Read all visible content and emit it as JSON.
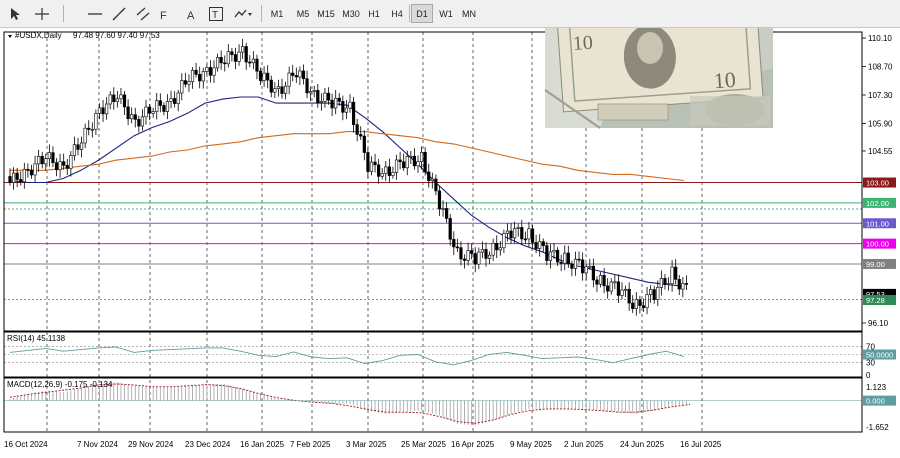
{
  "toolbar": {
    "timeframes": [
      "M1",
      "M5",
      "M15",
      "M30",
      "H1",
      "H4",
      "D1",
      "W1",
      "MN"
    ],
    "active_timeframe": "D1"
  },
  "chart_header": {
    "symbol_label": "#USDX,Daily",
    "ohlc": "97.48 97.60 97.40 97.53"
  },
  "price_axis": {
    "labels": [
      "110.10",
      "108.70",
      "107.30",
      "105.90",
      "104.55",
      "103.00",
      "102.00",
      "101.00",
      "100.00",
      "99.00",
      "97.53",
      "97.28",
      "96.10"
    ]
  },
  "levels": [
    {
      "price": 103.0,
      "label": "103.00",
      "color": "#8b1a1a",
      "style": "solid"
    },
    {
      "price": 102.0,
      "label": "102.00",
      "color": "#3cb371",
      "style": "solid"
    },
    {
      "price": 101.0,
      "label": "101.00",
      "color": "#6a5acd",
      "style": "solid"
    },
    {
      "price": 100.0,
      "label": "100.00",
      "color": "#ee00ee",
      "style": "solid"
    },
    {
      "price": 99.0,
      "label": "99.00",
      "color": "#808080",
      "style": "solid"
    }
  ],
  "current_price": {
    "bid": "97.53",
    "mark": "97.28"
  },
  "date_axis": {
    "labels": [
      "16 Oct 2024",
      "7 Nov 2024",
      "29 Nov 2024",
      "23 Dec 2024",
      "16 Jan 2025",
      "7 Feb 2025",
      "3 Mar 2025",
      "25 Mar 2025",
      "16 Apr 2025",
      "9 May 2025",
      "2 Jun 2025",
      "24 Jun 2025",
      "16 Jul 2025"
    ]
  },
  "rsi": {
    "label": "RSI(14) 45.1138",
    "levels": [
      "70",
      "50.0000",
      "30",
      "0"
    ],
    "line_color": "#5f9ea0"
  },
  "macd": {
    "label": "MACD(12,26,9) -0.175 -0.134",
    "levels": [
      "1.123",
      "0.000",
      "-1.652"
    ],
    "signal_color": "#a01020"
  },
  "chart_data": {
    "type": "line",
    "series": [],
    "title": "",
    "xlabel": "",
    "ylabel": "",
    "x": [
      "2024-10-09",
      "2024-10-16",
      "2024-10-23",
      "2024-10-30",
      "2024-11-07",
      "2024-11-14",
      "2024-11-21",
      "2024-11-29",
      "2024-12-06",
      "2024-12-13",
      "2024-12-23",
      "2024-12-30",
      "2025-01-06",
      "2025-01-16",
      "2025-01-23",
      "2025-01-30",
      "2025-02-07",
      "2025-02-14",
      "2025-02-21",
      "2025-03-03",
      "2025-03-10",
      "2025-03-17",
      "2025-03-25",
      "2025-04-01",
      "2025-04-08",
      "2025-04-16",
      "2025-04-23",
      "2025-05-01",
      "2025-05-09",
      "2025-05-16",
      "2025-05-23",
      "2025-06-02",
      "2025-06-09",
      "2025-06-16",
      "2025-06-24",
      "2025-07-01",
      "2025-07-08",
      "2025-07-16",
      "2025-07-22"
    ],
    "ylim": [
      96.1,
      110.1
    ],
    "candles_close": [
      103.0,
      103.6,
      104.2,
      103.8,
      105.0,
      106.6,
      107.2,
      106.0,
      106.6,
      107.0,
      108.1,
      108.5,
      109.0,
      109.5,
      108.2,
      107.5,
      108.4,
      107.3,
      106.9,
      106.7,
      103.8,
      103.5,
      104.0,
      104.2,
      102.0,
      99.5,
      99.3,
      99.7,
      100.6,
      100.4,
      99.5,
      99.2,
      98.9,
      98.1,
      97.8,
      96.9,
      97.6,
      98.5,
      97.5
    ],
    "ma_short": [
      103.1,
      103.0,
      103.0,
      103.2,
      103.6,
      104.1,
      104.7,
      105.3,
      105.7,
      106.0,
      106.4,
      106.9,
      107.1,
      107.2,
      107.2,
      106.9,
      106.9,
      106.9,
      106.9,
      106.8,
      106.2,
      105.5,
      104.7,
      103.9,
      103.0,
      102.2,
      101.4,
      100.8,
      100.3,
      99.9
    ],
    "ma_long": [
      103.6,
      103.6,
      103.6,
      103.7,
      103.8,
      103.9,
      104.1,
      104.2,
      104.3,
      104.5,
      104.6,
      104.8,
      104.9,
      105.0,
      105.2,
      105.3,
      105.4,
      105.4,
      105.4,
      105.5,
      105.5,
      105.4,
      105.3,
      105.2,
      105.0,
      104.9,
      104.7,
      104.5,
      104.3,
      104.1,
      103.9,
      103.8,
      103.6,
      103.5,
      103.4,
      103.4,
      103.3,
      103.2,
      103.1
    ],
    "rsi_values": [
      55,
      60,
      65,
      58,
      62,
      66,
      68,
      55,
      60,
      62,
      64,
      66,
      66,
      58,
      48,
      45,
      56,
      44,
      40,
      42,
      28,
      35,
      48,
      50,
      32,
      25,
      35,
      50,
      55,
      48,
      40,
      42,
      44,
      38,
      30,
      40,
      50,
      58,
      45
    ],
    "macd_hist": [
      0.1,
      0.4,
      0.6,
      0.5,
      0.8,
      1.0,
      1.1,
      0.9,
      0.8,
      0.8,
      0.9,
      1.0,
      1.0,
      0.7,
      0.4,
      0.1,
      0.0,
      -0.1,
      -0.2,
      -0.2,
      -0.6,
      -0.8,
      -0.7,
      -0.6,
      -0.9,
      -1.4,
      -1.5,
      -1.2,
      -0.8,
      -0.5,
      -0.5,
      -0.5,
      -0.5,
      -0.6,
      -0.7,
      -0.8,
      -0.6,
      -0.3,
      -0.2
    ]
  }
}
